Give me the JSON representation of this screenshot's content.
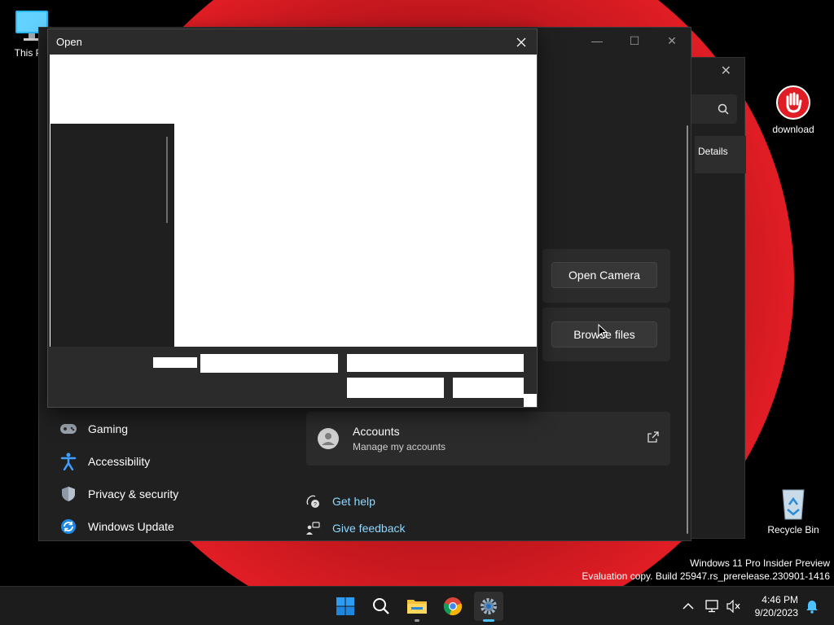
{
  "desktop": {
    "icons": [
      {
        "label": "This PC"
      },
      {
        "label": "download"
      },
      {
        "label": "Recycle Bin"
      }
    ],
    "watermark": {
      "line1": "Windows 11 Pro Insider Preview",
      "line2": "Evaluation copy. Build 25947.rs_prerelease.230901-1416"
    }
  },
  "back_dialog": {
    "details_label": "Details"
  },
  "settings": {
    "nav": [
      {
        "label": "Gaming",
        "icon": "gaming-icon"
      },
      {
        "label": "Accessibility",
        "icon": "accessibility-icon"
      },
      {
        "label": "Privacy & security",
        "icon": "shield-icon"
      },
      {
        "label": "Windows Update",
        "icon": "windows-update-icon"
      }
    ],
    "open_camera_label": "Open Camera",
    "browse_files_label": "Browse files",
    "accounts": {
      "title": "Accounts",
      "subtitle": "Manage my accounts"
    },
    "get_help_label": "Get help",
    "give_feedback_label": "Give feedback"
  },
  "open_dialog": {
    "title": "Open"
  },
  "taskbar": {
    "time": "4:46 PM",
    "date": "9/20/2023",
    "pinned": [
      "start-icon",
      "search-icon",
      "file-explorer-icon",
      "chrome-icon",
      "settings-icon"
    ]
  },
  "colors": {
    "accent_link": "#8fd8ff",
    "start_blue": "#0a84ff",
    "wallpaper_red": "#e01d24"
  }
}
